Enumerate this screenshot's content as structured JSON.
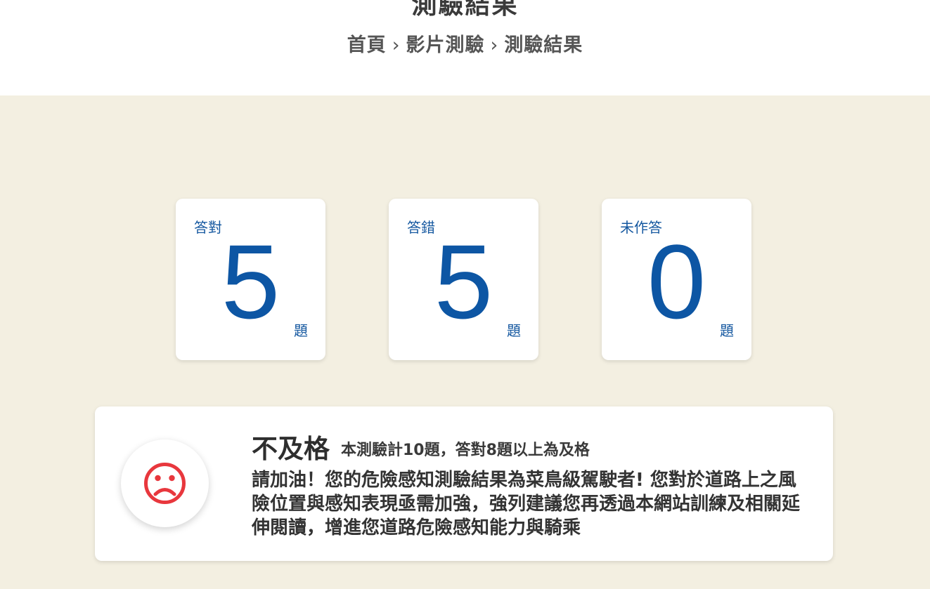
{
  "header": {
    "title": "測驗結果",
    "breadcrumb": [
      "首頁",
      "影片測驗",
      "測驗結果"
    ]
  },
  "stats": [
    {
      "label": "答對",
      "value": "5",
      "unit": "題"
    },
    {
      "label": "答錯",
      "value": "5",
      "unit": "題"
    },
    {
      "label": "未作答",
      "value": "0",
      "unit": "題"
    }
  ],
  "result": {
    "status": "不及格",
    "rule": "本測驗計10題，答對8題以上為及格",
    "description": "請加油！您的危險感知測驗結果為菜鳥級駕駛者! 您對於道路上之風險位置與感知表現亟需加強，強列建議您再透過本網站訓練及相關延伸閱讀，增進您道路危險感知能力與騎乘",
    "icon": "sad-face-icon"
  },
  "colors": {
    "accent_blue": "#0d56a4",
    "background": "#f3efe1",
    "sad_face": "#e8373d"
  }
}
